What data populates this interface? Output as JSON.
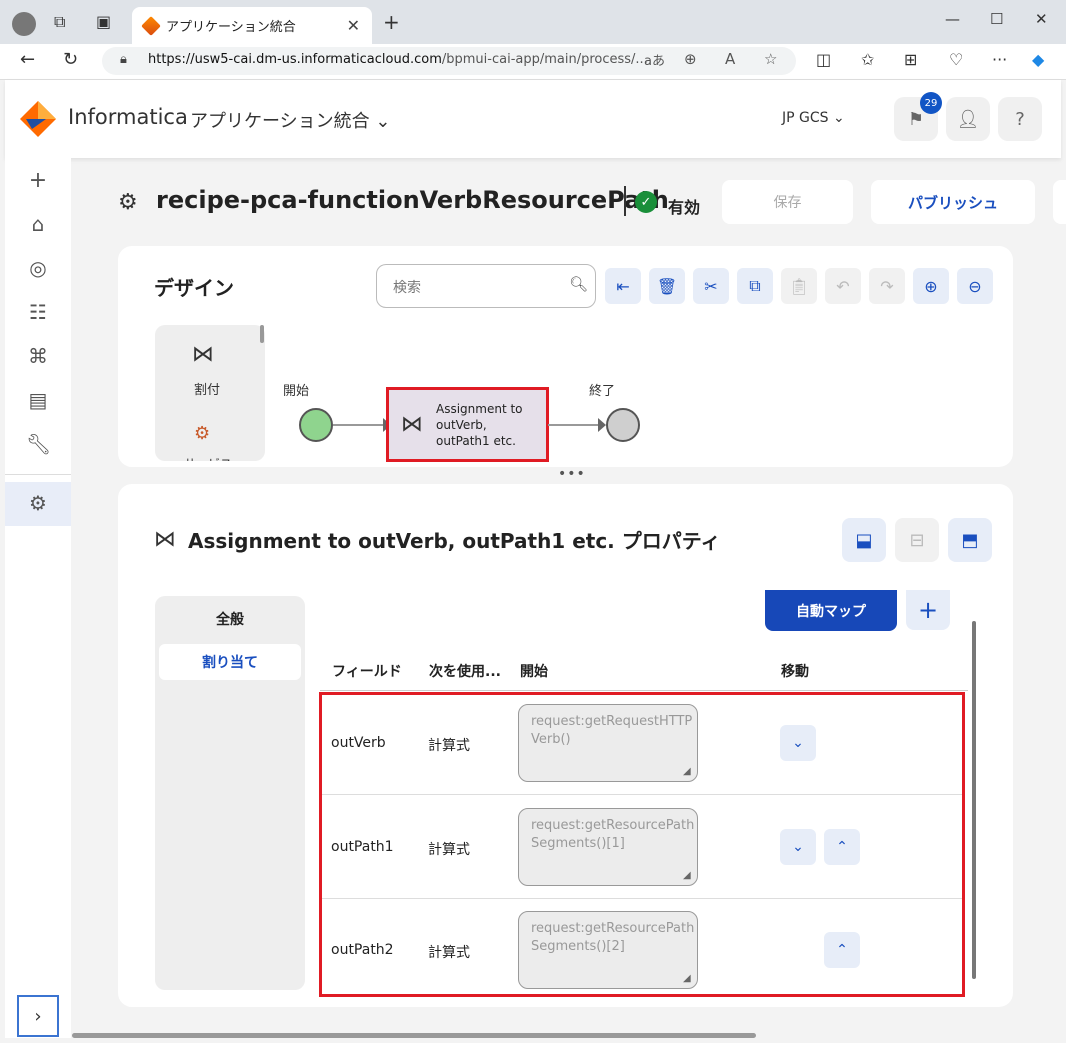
{
  "browser": {
    "tab_title": "アプリケーション統合",
    "tab_close": "✕",
    "new_tab": "+",
    "url_host": "https://usw5-cai.dm-us.informaticacloud.com",
    "url_path": "/bpmui-cai-app/main/process/...",
    "reader_label": "aあ"
  },
  "app": {
    "brand": "Informatica",
    "product": "アプリケーション統合",
    "org": "JP GCS",
    "notification_count": "29",
    "help": "?"
  },
  "page": {
    "title": "recipe-pca-functionVerbResourcePath",
    "status": "有効",
    "save_label": "保存",
    "publish_label": "パブリッシュ"
  },
  "design": {
    "title": "デザイン",
    "search_placeholder": "検索",
    "palette": [
      {
        "label": "割付"
      },
      {
        "label": "サービス"
      }
    ],
    "start_label": "開始",
    "end_label": "終了",
    "step_label": "Assignment to outVerb, outPath1 etc."
  },
  "properties": {
    "title": "Assignment to outVerb, outPath1 etc. プロパティ",
    "tabs": [
      "全般",
      "割り当て"
    ],
    "automap_label": "自動マップ",
    "add_label": "+",
    "columns": [
      "フィールド",
      "次を使用...",
      "開始",
      "移動"
    ],
    "rows": [
      {
        "field": "outVerb",
        "use": "計算式",
        "expression": "request:getRequestHTTPVerb()"
      },
      {
        "field": "outPath1",
        "use": "計算式",
        "expression": "request:getResourcePathSegments()[1]"
      },
      {
        "field": "outPath2",
        "use": "計算式",
        "expression": "request:getResourcePathSegments()[2]"
      }
    ]
  },
  "colors": {
    "accent": "#1a4fbf",
    "highlight": "#e01b24",
    "ok": "#1a8f3a"
  }
}
